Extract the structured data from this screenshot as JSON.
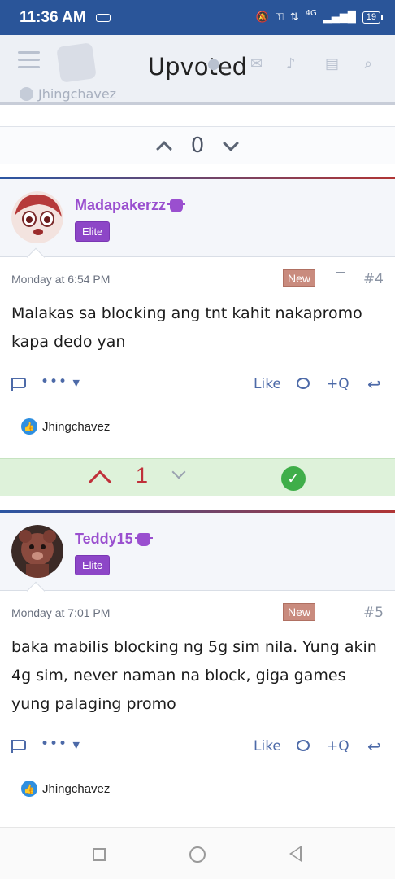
{
  "status_bar": {
    "time": "11:36 AM",
    "network": "4G",
    "battery": "19"
  },
  "app_bar": {
    "title": "Upvoted",
    "peek_username": "Jhingchavez"
  },
  "vote_top": {
    "score": "0"
  },
  "posts": [
    {
      "username": "Madapakerzz",
      "badge": "Elite",
      "date": "Monday at 6:54 PM",
      "new_label": "New",
      "number": "#4",
      "body": "Malakas sa blocking ang tnt kahit nakapromo kapa dedo yan",
      "actions": {
        "more": "•••",
        "like": "Like",
        "quote": "+Q"
      },
      "reaction_user": "Jhingchavez"
    },
    {
      "username": "Teddy15",
      "badge": "Elite",
      "date": "Monday at 7:01 PM",
      "new_label": "New",
      "number": "#5",
      "body": "baka mabilis blocking ng 5g sim nila. Yung akin 4g sim, never naman na block, giga games yung palaging promo",
      "actions": {
        "more": "•••",
        "like": "Like",
        "quote": "+Q"
      },
      "reaction_user": "Jhingchavez"
    }
  ],
  "vote_middle": {
    "score": "1"
  },
  "colors": {
    "status_bar": "#2a5599",
    "username": "#9a4fcf",
    "badge": "#8d46c7",
    "upvote": "#c0303a",
    "accepted": "#3fae49"
  }
}
